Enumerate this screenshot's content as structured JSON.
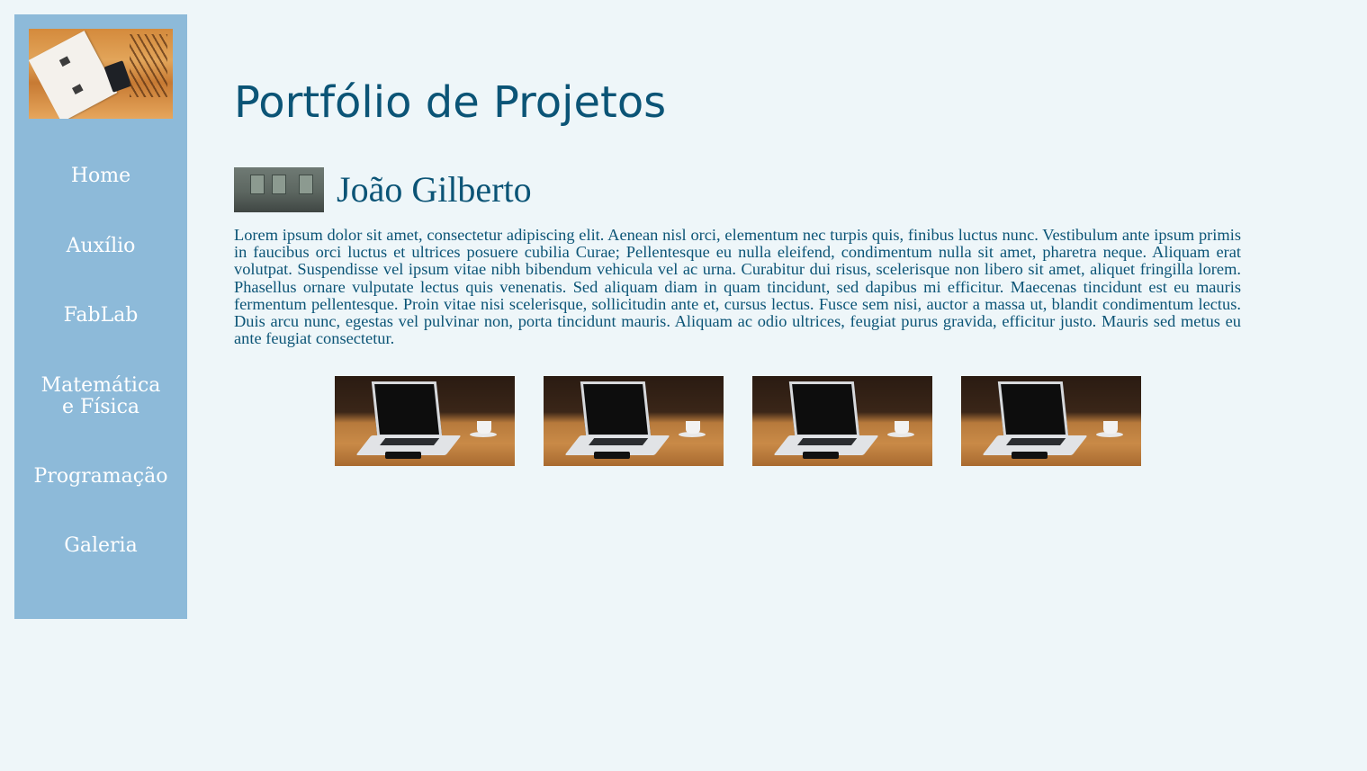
{
  "sidebar": {
    "items": [
      {
        "label": "Home"
      },
      {
        "label": "Auxílio"
      },
      {
        "label": "FabLab"
      },
      {
        "label": "Matemática e Física"
      },
      {
        "label": "Programação"
      },
      {
        "label": "Galeria"
      }
    ]
  },
  "main": {
    "title": "Portfólio de Projetos",
    "profile": {
      "name": "João Gilberto",
      "description": "Lorem ipsum dolor sit amet, consectetur adipiscing elit. Aenean nisl orci, elementum nec turpis quis, finibus luctus nunc. Vestibulum ante ipsum primis in faucibus orci luctus et ultrices posuere cubilia Curae; Pellentesque eu nulla eleifend, condimentum nulla sit amet, pharetra neque. Aliquam erat volutpat. Suspendisse vel ipsum vitae nibh bibendum vehicula vel ac urna. Curabitur dui risus, scelerisque non libero sit amet, aliquet fringilla lorem. Phasellus ornare vulputate lectus quis venenatis. Sed aliquam diam in quam tincidunt, sed dapibus mi efficitur. Maecenas tincidunt est eu mauris fermentum pellentesque. Proin vitae nisi scelerisque, sollicitudin ante et, cursus lectus. Fusce sem nisi, auctor a massa ut, blandit condimentum lectus. Duis arcu nunc, egestas vel pulvinar non, porta tincidunt mauris. Aliquam ac odio ultrices, feugiat purus gravida, efficitur justo. Mauris sed metus eu ante feugiat consectetur."
    }
  },
  "colors": {
    "background": "#eef6f9",
    "sidebar": "#8dbad9",
    "text": "#0b5476",
    "nav_text": "#ffffff"
  }
}
